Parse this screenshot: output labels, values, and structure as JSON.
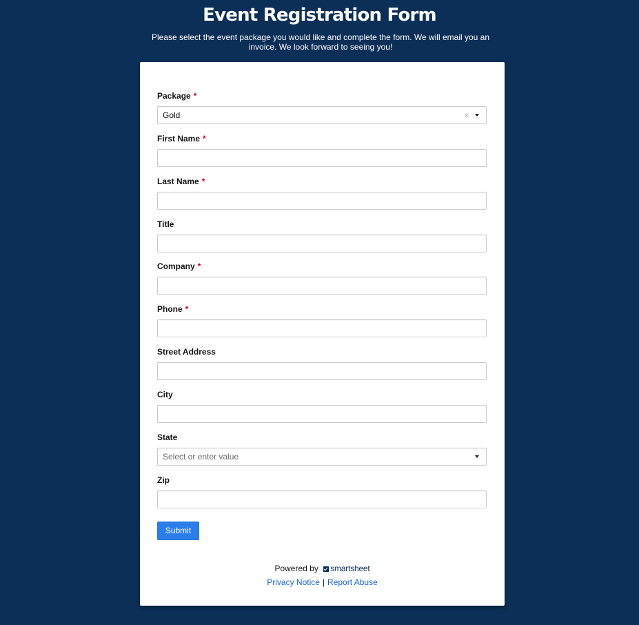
{
  "header": {
    "title": "Event Registration Form",
    "description": "Please select the event package you would like and complete the form. We will email you an invoice. We look forward to seeing you!"
  },
  "form": {
    "required_marker": "*",
    "fields": [
      {
        "label": "Package",
        "required": true,
        "type": "select",
        "value": "Gold",
        "clear_icon": "×"
      },
      {
        "label": "First Name",
        "required": true,
        "type": "text",
        "value": ""
      },
      {
        "label": "Last Name",
        "required": true,
        "type": "text",
        "value": ""
      },
      {
        "label": "Title",
        "required": false,
        "type": "text",
        "value": ""
      },
      {
        "label": "Company",
        "required": true,
        "type": "text",
        "value": ""
      },
      {
        "label": "Phone",
        "required": true,
        "type": "text",
        "value": ""
      },
      {
        "label": "Street Address",
        "required": false,
        "type": "text",
        "value": ""
      },
      {
        "label": "City",
        "required": false,
        "type": "text",
        "value": ""
      },
      {
        "label": "State",
        "required": false,
        "type": "select",
        "value": "",
        "placeholder": "Select or enter value"
      },
      {
        "label": "Zip",
        "required": false,
        "type": "text",
        "value": ""
      }
    ],
    "submit_label": "Submit"
  },
  "footer": {
    "powered_by": "Powered by",
    "brand": "smartsheet",
    "privacy_link": "Privacy Notice",
    "separator": "|",
    "report_link": "Report Abuse"
  },
  "colors": {
    "background": "#0b2f57",
    "accent": "#2b7de9",
    "required": "#d0021b",
    "link": "#1a65c9"
  }
}
